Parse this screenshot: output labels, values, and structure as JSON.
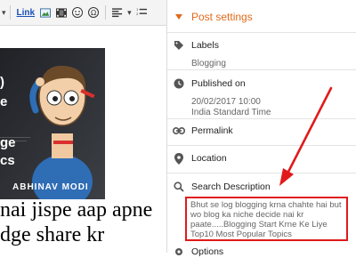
{
  "toolbar": {
    "dropdown_caret": "▾",
    "link_label": "Link",
    "icons": [
      "image-icon",
      "video-icon",
      "emoji-icon",
      "special-chars-icon",
      "align-icon",
      "list-icon"
    ]
  },
  "post": {
    "image_fragments": [
      ")",
      "e",
      "ge",
      "cs"
    ],
    "image_brand": "ABHINAV MODI",
    "text_lines": [
      "nai jispe aap apne",
      "dge share kr"
    ]
  },
  "post_settings": {
    "title": "Post settings",
    "labels": {
      "label": "Labels",
      "value": "Blogging"
    },
    "published_on": {
      "label": "Published on",
      "date": "20/02/2017 10:00",
      "timezone": "India Standard Time"
    },
    "permalink": {
      "label": "Permalink"
    },
    "location": {
      "label": "Location"
    },
    "search_description": {
      "label": "Search Description",
      "value": "Bhut se log blogging krna chahte hai but wo blog ka niche decide nai kr paate.....Blogging Start Krne Ke Liye Top10 Most Popular Topics"
    },
    "options": {
      "label": "Options"
    }
  },
  "colors": {
    "accent": "#e06a1b",
    "highlight": "#e01a1a"
  }
}
